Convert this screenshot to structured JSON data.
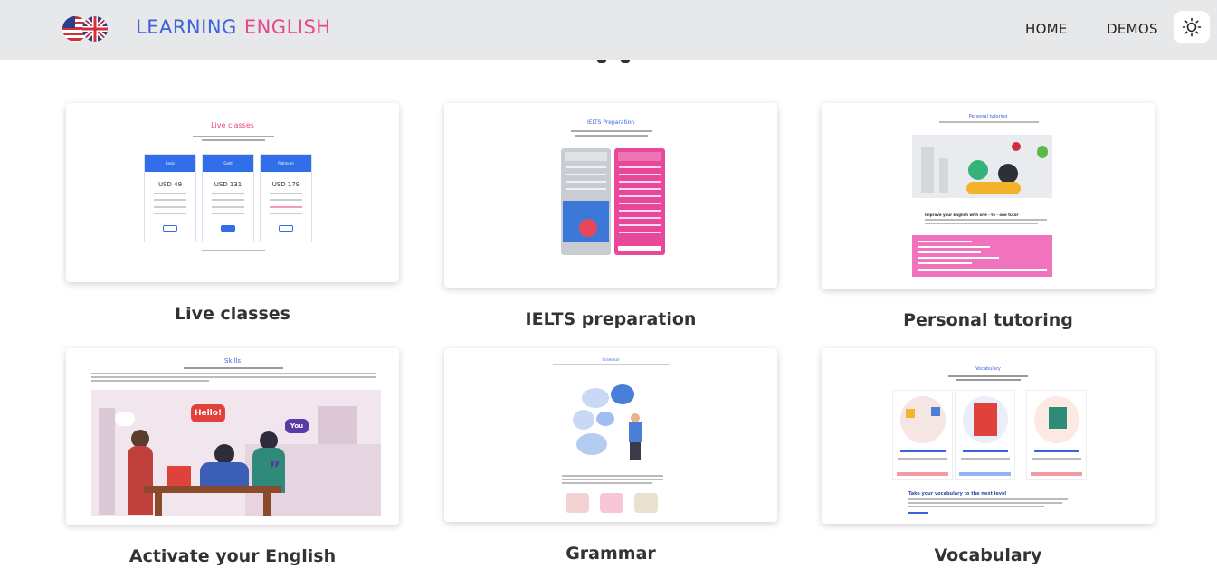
{
  "header": {
    "brand_part1": "LEARNING",
    "brand_part2": "ENGLISH",
    "nav": [
      {
        "label": "HOME"
      },
      {
        "label": "DEMOS"
      }
    ],
    "theme_toggle_icon": "sun-icon",
    "colors": {
      "brand_blue": "#3b63db",
      "brand_pink": "#e8478f",
      "topbar_bg": "#e7e8ea"
    }
  },
  "cards": [
    {
      "title": "Live classes",
      "preview": {
        "heading": "Live classes",
        "plans": [
          {
            "name": "Basic",
            "price": "USD 49"
          },
          {
            "name": "Gold",
            "price": "USD 131"
          },
          {
            "name": "Platinum",
            "price": "USD 179"
          }
        ]
      }
    },
    {
      "title": "IELTS preparation",
      "preview": {
        "heading": "IELTS Preparation"
      }
    },
    {
      "title": "Personal tutoring",
      "preview": {
        "heading": "Personal tutoring",
        "subheading": "Improve your English with one - to - one tutor"
      }
    },
    {
      "title": "Activate your English",
      "preview": {
        "heading": "Skills",
        "bubble1": "Hello!",
        "bubble2": "You"
      }
    },
    {
      "title": "Grammar",
      "preview": {
        "heading": "Grammar"
      }
    },
    {
      "title": "Vocabulary",
      "preview": {
        "heading": "Vocabulary",
        "subheading": "Take your vocabulary to the next level"
      }
    }
  ]
}
